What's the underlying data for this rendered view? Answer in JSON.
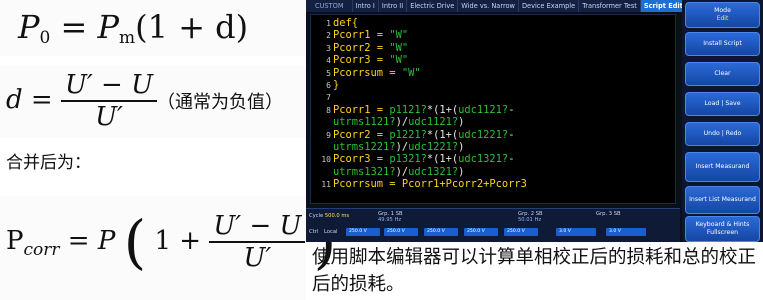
{
  "formulas": {
    "f1": {
      "lhs": "P",
      "lhs_sub": "0",
      "eq": "=",
      "p": "P",
      "p_sub": "m",
      "rest": "(1 + d)"
    },
    "f2": {
      "lhs": "d =",
      "num": "U′ − U",
      "den": "U′",
      "note": "（通常为负值）"
    },
    "merge_text": "合并后为：",
    "f4": {
      "lhs": "P",
      "lhs_sub": "corr",
      "eq": "= P",
      "open": "(",
      "one_plus": "1 +",
      "num": "U′ − U",
      "den": "U′",
      "close": ")"
    }
  },
  "scope": {
    "tabs": [
      "CUSTOM",
      "Intro I",
      "Intro II",
      "Electric Drive",
      "Wide vs. Narrow",
      "Device Example",
      "Transformer Test",
      "Script Editor"
    ],
    "active_tab": "Script Editor",
    "code_lines": [
      {
        "n": "1",
        "parts": [
          {
            "t": "def{",
            "c": "y"
          }
        ]
      },
      {
        "n": "2",
        "parts": [
          {
            "t": "Pcorr1 = ",
            "c": "y"
          },
          {
            "t": "\"W\"",
            "c": "g"
          }
        ]
      },
      {
        "n": "3",
        "parts": [
          {
            "t": "Pcorr2 = ",
            "c": "y"
          },
          {
            "t": "\"W\"",
            "c": "g"
          }
        ]
      },
      {
        "n": "4",
        "parts": [
          {
            "t": "Pcorr3 = ",
            "c": "y"
          },
          {
            "t": "\"W\"",
            "c": "g"
          }
        ]
      },
      {
        "n": "5",
        "parts": [
          {
            "t": "Pcorrsum = ",
            "c": "y"
          },
          {
            "t": "\"W\"",
            "c": "g"
          }
        ]
      },
      {
        "n": "6",
        "parts": [
          {
            "t": "}",
            "c": "y"
          }
        ]
      },
      {
        "n": "7",
        "parts": []
      },
      {
        "n": "8",
        "parts": [
          {
            "t": "Pcorr1 = ",
            "c": "y"
          },
          {
            "t": "p1121?",
            "c": "g"
          },
          {
            "t": "*(1+(",
            "c": "w"
          },
          {
            "t": "udc1121?",
            "c": "g"
          },
          {
            "t": "-",
            "c": "w"
          }
        ]
      },
      {
        "n": "",
        "parts": [
          {
            "t": "utrms1121?",
            "c": "g"
          },
          {
            "t": ")/",
            "c": "w"
          },
          {
            "t": "udc1121?",
            "c": "g"
          },
          {
            "t": ")",
            "c": "w"
          }
        ]
      },
      {
        "n": "9",
        "parts": [
          {
            "t": "Pcorr2 = ",
            "c": "y"
          },
          {
            "t": "p1221?",
            "c": "g"
          },
          {
            "t": "*(1+(",
            "c": "w"
          },
          {
            "t": "udc1221?",
            "c": "g"
          },
          {
            "t": "-",
            "c": "w"
          }
        ]
      },
      {
        "n": "",
        "parts": [
          {
            "t": "utrms1221?",
            "c": "g"
          },
          {
            "t": ")/",
            "c": "w"
          },
          {
            "t": "udc1221?",
            "c": "g"
          },
          {
            "t": ")",
            "c": "w"
          }
        ]
      },
      {
        "n": "10",
        "parts": [
          {
            "t": "Pcorr3 = ",
            "c": "y"
          },
          {
            "t": "p1321?",
            "c": "g"
          },
          {
            "t": "*(1+(",
            "c": "w"
          },
          {
            "t": "udc1321?",
            "c": "g"
          },
          {
            "t": "-",
            "c": "w"
          }
        ]
      },
      {
        "n": "",
        "parts": [
          {
            "t": "utrms1321?",
            "c": "g"
          },
          {
            "t": ")/",
            "c": "w"
          },
          {
            "t": "udc1321?",
            "c": "g"
          },
          {
            "t": ")",
            "c": "w"
          }
        ]
      },
      {
        "n": "11",
        "parts": [
          {
            "t": "Pcorrsum = Pcorr1+Pcorr2+Pcorr3",
            "c": "y"
          }
        ]
      }
    ],
    "sidebar": [
      {
        "label": "Mode",
        "sub": "Edit"
      },
      {
        "label": "Install Script",
        "sub": ""
      },
      {
        "label": "Clear",
        "sub": ""
      },
      {
        "label": "Load | Save",
        "sub": ""
      },
      {
        "label": "Undo | Redo",
        "sub": ""
      },
      {
        "label": "Insert Measurand",
        "sub": ""
      },
      {
        "label": "Insert List Measurand",
        "sub": ""
      },
      {
        "label": "Keyboard & Hints Fullscreen",
        "sub": ""
      }
    ],
    "status": {
      "cycle_label": "Cycle",
      "cycle_value": "500.0 ms",
      "ctrl": "Ctrl",
      "local": "Local",
      "groups": [
        {
          "name": "Grp. 1 SB",
          "freq": "49.95 Hz"
        },
        {
          "name": "Grp. 2 SB",
          "freq": "50.01 Hz"
        },
        {
          "name": "Grp. 3 SB",
          "freq": ""
        }
      ],
      "bars": [
        "250.0 V",
        "250.0 V",
        "250.0 V",
        "250.0 V",
        "250.0 V",
        "3.0 V",
        "3.0 V"
      ]
    }
  },
  "caption": "使用脚本编辑器可以计算单相校正后的损耗和总的校正后的损耗。",
  "colors": {
    "code_yellow": "#ffd21e",
    "code_green": "#2fbf3a",
    "button_blue": "#1e6fd0"
  }
}
